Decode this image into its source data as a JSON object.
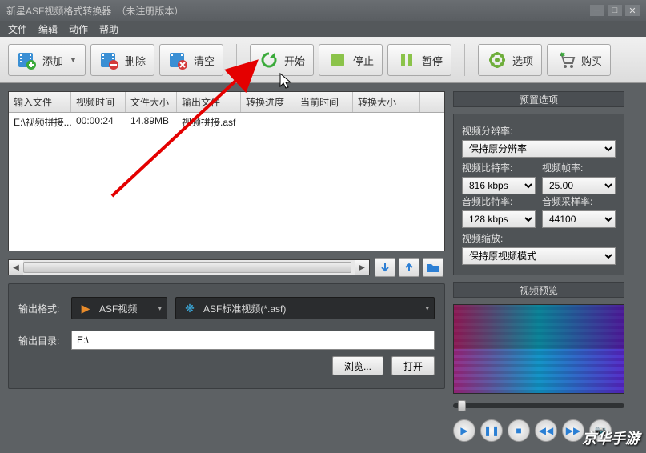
{
  "titlebar": {
    "app_name": "新星ASF视频格式转换器",
    "version_note": "（未注册版本）"
  },
  "menu": {
    "file": "文件",
    "edit": "编辑",
    "action": "动作",
    "help": "帮助"
  },
  "toolbar": {
    "add": "添加",
    "delete": "删除",
    "clear": "清空",
    "start": "开始",
    "stop": "停止",
    "pause": "暂停",
    "options": "选项",
    "buy": "购买"
  },
  "table": {
    "headers": {
      "input": "输入文件",
      "vtime": "视频时间",
      "fsize": "文件大小",
      "output": "输出文件",
      "progress": "转换进度",
      "curtime": "当前时间",
      "csize": "转换大小"
    },
    "rows": [
      {
        "input": "E:\\视频拼接...",
        "vtime": "00:00:24",
        "fsize": "14.89MB",
        "output": "视频拼接.asf",
        "progress": "",
        "curtime": "",
        "csize": ""
      }
    ]
  },
  "output": {
    "format_label": "输出格式:",
    "format_group": "ASF视频",
    "format_detail": "ASF标准视频(*.asf)",
    "dir_label": "输出目录:",
    "dir_value": "E:\\",
    "browse": "浏览...",
    "open": "打开"
  },
  "preset": {
    "title": "预置选项",
    "res_label": "视频分辨率:",
    "res_value": "保持原分辨率",
    "vbr_label": "视频比特率:",
    "vbr_value": "816 kbps",
    "fps_label": "视频帧率:",
    "fps_value": "25.00",
    "abr_label": "音频比特率:",
    "abr_value": "128 kbps",
    "asr_label": "音频采样率:",
    "asr_value": "44100",
    "zoom_label": "视频缩放:",
    "zoom_value": "保持原视频模式"
  },
  "preview": {
    "title": "视频预览"
  },
  "watermark": "京华手游"
}
